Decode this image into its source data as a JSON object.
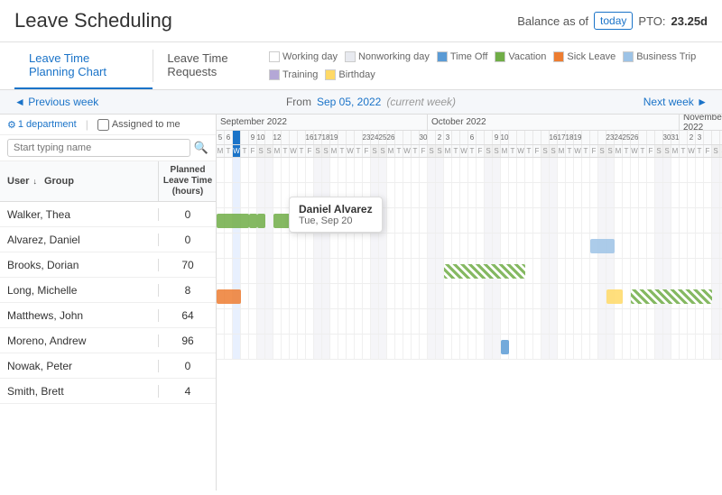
{
  "header": {
    "title": "Leave Scheduling",
    "balance_label": "Balance as of",
    "balance_date": "today",
    "pto_label": "PTO:",
    "pto_value": "23.25d"
  },
  "tabs": {
    "tab1": "Leave Time Planning Chart",
    "tab2": "Leave Time Requests"
  },
  "legend": {
    "working": "Working day",
    "nonworking": "Nonworking day",
    "timeoff": "Time Off",
    "vacation": "Vacation",
    "sick": "Sick Leave",
    "business": "Business Trip",
    "training": "Training",
    "birthday": "Birthday"
  },
  "nav": {
    "prev": "◄ Previous week",
    "from": "From",
    "date": "Sep 05, 2022",
    "current": "(current week)",
    "next": "Next week ►"
  },
  "filters": {
    "department": "1 department",
    "assigned_label": "Assigned to me",
    "search_placeholder": "Start typing name"
  },
  "col_headers": {
    "user": "User",
    "group": "Group",
    "planned": "Planned Leave Time (hours)"
  },
  "users": [
    {
      "name": "Walker, Thea",
      "hours": "0"
    },
    {
      "name": "Alvarez, Daniel",
      "hours": "0"
    },
    {
      "name": "Brooks, Dorian",
      "hours": "70"
    },
    {
      "name": "Long, Michelle",
      "hours": "8"
    },
    {
      "name": "Matthews, John",
      "hours": "64"
    },
    {
      "name": "Moreno, Andrew",
      "hours": "96"
    },
    {
      "name": "Nowak, Peter",
      "hours": "0"
    },
    {
      "name": "Smith, Brett",
      "hours": "4"
    }
  ],
  "tooltip": {
    "name": "Daniel Alvarez",
    "date": "Tue, Sep 20"
  }
}
